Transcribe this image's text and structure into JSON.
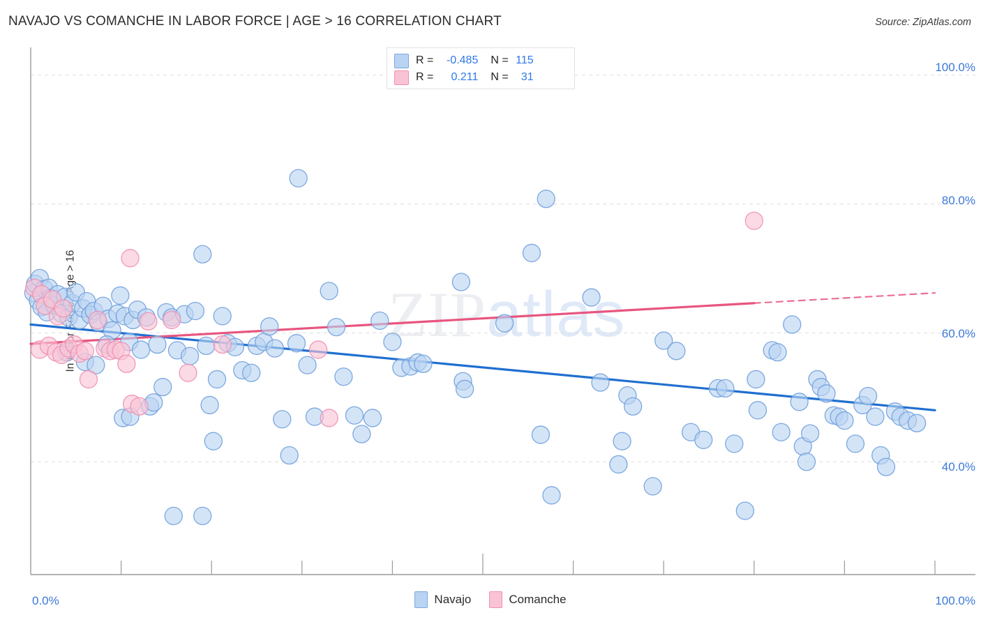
{
  "header": {
    "title": "NAVAJO VS COMANCHE IN LABOR FORCE | AGE > 16 CORRELATION CHART",
    "source": "Source: ZipAtlas.com"
  },
  "watermark": {
    "part1": "ZIP",
    "part2": "atlas"
  },
  "stats_legend": {
    "rows": [
      {
        "series": "Navajo",
        "r_label": "R =",
        "r_value": "-0.485",
        "n_label": "N =",
        "n_value": "115",
        "color": "#b9d3f2"
      },
      {
        "series": "Comanche",
        "r_label": "R =",
        "r_value": "0.211",
        "n_label": "N =",
        "n_value": "31",
        "color": "#f9c3d5"
      }
    ]
  },
  "bottom_legend": {
    "items": [
      {
        "label": "Navajo",
        "color": "#b9d3f2"
      },
      {
        "label": "Comanche",
        "color": "#f9c3d5"
      }
    ]
  },
  "chart_data": {
    "type": "scatter",
    "title": "NAVAJO VS COMANCHE IN LABOR FORCE | AGE > 16 CORRELATION CHART",
    "xlabel": "",
    "ylabel": "In Labor Force | Age > 16",
    "xlim": [
      0,
      100
    ],
    "ylim": [
      22.5,
      103
    ],
    "grid": true,
    "legend_position": "bottom-center",
    "x_tick_labels": [
      "0.0%",
      "100.0%"
    ],
    "y_tick_labels": [
      "40.0%",
      "60.0%",
      "80.0%",
      "100.0%"
    ],
    "y_ticks": [
      40,
      60,
      80,
      100
    ],
    "colors": {
      "navajo_fill": "#b9d3f2",
      "navajo_edge": "#6fa0db",
      "comanche_fill": "#f9c3d5",
      "comanche_edge": "#ef8fb0",
      "navajo_trend": "#1f6fd0",
      "comanche_trend": "#e8557f",
      "axis": "#9a9a9a",
      "grid": "#dddddd",
      "tick_text": "#3b78d8"
    },
    "series": [
      {
        "name": "Navajo",
        "r": -0.485,
        "n": 115,
        "marker_fill": "#b9d3f2",
        "marker_edge": "#6fa0db",
        "trend": {
          "x0": 0,
          "y0": 61.3,
          "x1": 100,
          "y1": 48.0,
          "color": "#1f6fd0",
          "dashed_from": 100
        },
        "points": [
          [
            0.3,
            66.2
          ],
          [
            0.5,
            67.6
          ],
          [
            0.8,
            65.0
          ],
          [
            1.0,
            68.5
          ],
          [
            1.2,
            64.0
          ],
          [
            1.5,
            66.8
          ],
          [
            1.8,
            63.2
          ],
          [
            2.0,
            67.0
          ],
          [
            2.2,
            65.4
          ],
          [
            2.6,
            64.3
          ],
          [
            3.0,
            66.0
          ],
          [
            3.4,
            63.0
          ],
          [
            3.8,
            65.6
          ],
          [
            4.2,
            62.4
          ],
          [
            4.6,
            64.6
          ],
          [
            5.0,
            66.3
          ],
          [
            5.4,
            62.0
          ],
          [
            5.8,
            63.8
          ],
          [
            6.2,
            64.9
          ],
          [
            6.6,
            62.8
          ],
          [
            7.0,
            63.4
          ],
          [
            7.5,
            61.6
          ],
          [
            8.0,
            64.2
          ],
          [
            8.6,
            62.2
          ],
          [
            9.0,
            60.4
          ],
          [
            9.6,
            63.0
          ],
          [
            4.0,
            57.0
          ],
          [
            6.0,
            55.5
          ],
          [
            7.2,
            55.0
          ],
          [
            8.4,
            58.2
          ],
          [
            9.9,
            65.8
          ],
          [
            10.4,
            62.6
          ],
          [
            10.9,
            58.6
          ],
          [
            11.3,
            62.0
          ],
          [
            11.8,
            63.6
          ],
          [
            12.2,
            57.4
          ],
          [
            12.8,
            62.4
          ],
          [
            13.2,
            48.6
          ],
          [
            13.6,
            49.2
          ],
          [
            14.0,
            58.2
          ],
          [
            14.6,
            51.6
          ],
          [
            10.2,
            46.8
          ],
          [
            11.0,
            47.0
          ],
          [
            15.0,
            63.2
          ],
          [
            15.6,
            62.4
          ],
          [
            16.2,
            57.3
          ],
          [
            17.0,
            62.9
          ],
          [
            17.6,
            56.4
          ],
          [
            18.2,
            63.4
          ],
          [
            19.0,
            72.2
          ],
          [
            19.4,
            58.0
          ],
          [
            19.8,
            48.8
          ],
          [
            20.2,
            43.2
          ],
          [
            20.6,
            52.8
          ],
          [
            21.2,
            62.6
          ],
          [
            21.8,
            58.4
          ],
          [
            22.6,
            57.8
          ],
          [
            23.4,
            54.2
          ],
          [
            24.4,
            53.8
          ],
          [
            25.0,
            58.0
          ],
          [
            25.8,
            58.6
          ],
          [
            26.4,
            61.0
          ],
          [
            27.0,
            57.6
          ],
          [
            27.8,
            46.6
          ],
          [
            28.6,
            41.0
          ],
          [
            29.4,
            58.4
          ],
          [
            30.6,
            55.0
          ],
          [
            31.4,
            47.0
          ],
          [
            33.0,
            66.5
          ],
          [
            33.8,
            60.9
          ],
          [
            34.6,
            53.2
          ],
          [
            35.8,
            47.2
          ],
          [
            36.6,
            44.3
          ],
          [
            37.8,
            46.8
          ],
          [
            38.6,
            61.9
          ],
          [
            40.0,
            58.6
          ],
          [
            41.0,
            54.6
          ],
          [
            42.0,
            54.8
          ],
          [
            42.8,
            55.4
          ],
          [
            43.4,
            55.2
          ],
          [
            47.6,
            67.9
          ],
          [
            47.8,
            52.5
          ],
          [
            48.0,
            51.3
          ],
          [
            52.4,
            61.5
          ],
          [
            57.0,
            80.8
          ],
          [
            56.4,
            44.2
          ],
          [
            57.6,
            34.8
          ],
          [
            55.4,
            72.4
          ],
          [
            62.0,
            65.5
          ],
          [
            63.0,
            52.3
          ],
          [
            65.0,
            39.6
          ],
          [
            65.4,
            43.2
          ],
          [
            66.0,
            50.3
          ],
          [
            66.6,
            48.6
          ],
          [
            68.8,
            36.2
          ],
          [
            70.0,
            58.8
          ],
          [
            71.4,
            57.2
          ],
          [
            73.0,
            44.6
          ],
          [
            74.4,
            43.4
          ],
          [
            76.0,
            51.4
          ],
          [
            76.8,
            51.4
          ],
          [
            77.8,
            42.8
          ],
          [
            79.0,
            32.4
          ],
          [
            80.2,
            52.8
          ],
          [
            80.4,
            48.0
          ],
          [
            82.0,
            57.3
          ],
          [
            82.6,
            57.0
          ],
          [
            83.0,
            44.6
          ],
          [
            84.2,
            61.3
          ],
          [
            85.0,
            49.3
          ],
          [
            85.4,
            42.4
          ],
          [
            85.8,
            40.0
          ],
          [
            86.2,
            44.4
          ],
          [
            87.0,
            52.8
          ],
          [
            87.4,
            51.6
          ],
          [
            88.0,
            50.6
          ],
          [
            88.8,
            47.2
          ],
          [
            89.4,
            47.0
          ],
          [
            90.0,
            46.4
          ],
          [
            91.2,
            42.8
          ],
          [
            92.0,
            48.8
          ],
          [
            92.6,
            50.2
          ],
          [
            93.4,
            47.0
          ],
          [
            94.0,
            41.0
          ],
          [
            94.6,
            39.2
          ],
          [
            95.6,
            47.8
          ],
          [
            96.2,
            47.0
          ],
          [
            97.0,
            46.4
          ],
          [
            98.0,
            46.0
          ],
          [
            29.6,
            84.0
          ],
          [
            15.8,
            31.6
          ],
          [
            19.0,
            31.6
          ]
        ]
      },
      {
        "name": "Comanche",
        "r": 0.211,
        "n": 31,
        "marker_fill": "#f9c3d5",
        "marker_edge": "#ef8fb0",
        "trend": {
          "x0": 0,
          "y0": 58.3,
          "x1": 100,
          "y1": 66.2,
          "color": "#e8557f",
          "dashed_from": 80
        },
        "points": [
          [
            0.4,
            67.0
          ],
          [
            1.2,
            66.0
          ],
          [
            1.6,
            64.2
          ],
          [
            2.4,
            65.2
          ],
          [
            3.0,
            62.6
          ],
          [
            3.6,
            63.8
          ],
          [
            1.0,
            57.4
          ],
          [
            2.0,
            58.0
          ],
          [
            2.8,
            57.0
          ],
          [
            3.4,
            56.6
          ],
          [
            4.2,
            57.6
          ],
          [
            4.8,
            58.2
          ],
          [
            5.4,
            56.8
          ],
          [
            6.0,
            57.2
          ],
          [
            6.4,
            52.8
          ],
          [
            7.4,
            62.0
          ],
          [
            8.2,
            57.6
          ],
          [
            8.8,
            57.2
          ],
          [
            9.4,
            57.4
          ],
          [
            10.0,
            57.2
          ],
          [
            10.6,
            55.2
          ],
          [
            11.2,
            49.0
          ],
          [
            12.0,
            48.6
          ],
          [
            13.0,
            61.8
          ],
          [
            15.6,
            62.0
          ],
          [
            17.4,
            53.8
          ],
          [
            21.2,
            58.2
          ],
          [
            11.0,
            71.6
          ],
          [
            33.0,
            46.8
          ],
          [
            31.8,
            57.4
          ],
          [
            80.0,
            77.4
          ]
        ]
      }
    ]
  }
}
